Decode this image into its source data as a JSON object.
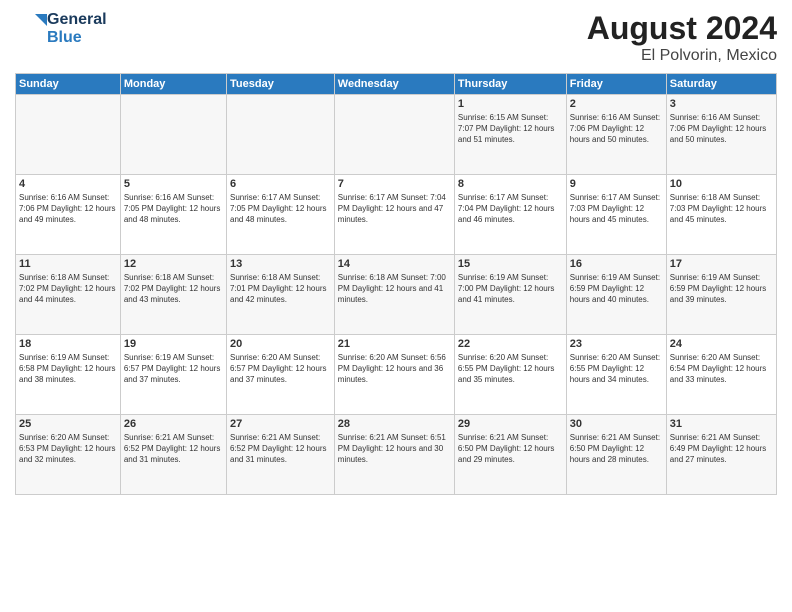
{
  "logo": {
    "line1": "General",
    "line2": "Blue"
  },
  "title": "August 2024",
  "subtitle": "El Polvorin, Mexico",
  "headers": [
    "Sunday",
    "Monday",
    "Tuesday",
    "Wednesday",
    "Thursday",
    "Friday",
    "Saturday"
  ],
  "weeks": [
    [
      {
        "day": "",
        "info": ""
      },
      {
        "day": "",
        "info": ""
      },
      {
        "day": "",
        "info": ""
      },
      {
        "day": "",
        "info": ""
      },
      {
        "day": "1",
        "info": "Sunrise: 6:15 AM\nSunset: 7:07 PM\nDaylight: 12 hours\nand 51 minutes."
      },
      {
        "day": "2",
        "info": "Sunrise: 6:16 AM\nSunset: 7:06 PM\nDaylight: 12 hours\nand 50 minutes."
      },
      {
        "day": "3",
        "info": "Sunrise: 6:16 AM\nSunset: 7:06 PM\nDaylight: 12 hours\nand 50 minutes."
      }
    ],
    [
      {
        "day": "4",
        "info": "Sunrise: 6:16 AM\nSunset: 7:06 PM\nDaylight: 12 hours\nand 49 minutes."
      },
      {
        "day": "5",
        "info": "Sunrise: 6:16 AM\nSunset: 7:05 PM\nDaylight: 12 hours\nand 48 minutes."
      },
      {
        "day": "6",
        "info": "Sunrise: 6:17 AM\nSunset: 7:05 PM\nDaylight: 12 hours\nand 48 minutes."
      },
      {
        "day": "7",
        "info": "Sunrise: 6:17 AM\nSunset: 7:04 PM\nDaylight: 12 hours\nand 47 minutes."
      },
      {
        "day": "8",
        "info": "Sunrise: 6:17 AM\nSunset: 7:04 PM\nDaylight: 12 hours\nand 46 minutes."
      },
      {
        "day": "9",
        "info": "Sunrise: 6:17 AM\nSunset: 7:03 PM\nDaylight: 12 hours\nand 45 minutes."
      },
      {
        "day": "10",
        "info": "Sunrise: 6:18 AM\nSunset: 7:03 PM\nDaylight: 12 hours\nand 45 minutes."
      }
    ],
    [
      {
        "day": "11",
        "info": "Sunrise: 6:18 AM\nSunset: 7:02 PM\nDaylight: 12 hours\nand 44 minutes."
      },
      {
        "day": "12",
        "info": "Sunrise: 6:18 AM\nSunset: 7:02 PM\nDaylight: 12 hours\nand 43 minutes."
      },
      {
        "day": "13",
        "info": "Sunrise: 6:18 AM\nSunset: 7:01 PM\nDaylight: 12 hours\nand 42 minutes."
      },
      {
        "day": "14",
        "info": "Sunrise: 6:18 AM\nSunset: 7:00 PM\nDaylight: 12 hours\nand 41 minutes."
      },
      {
        "day": "15",
        "info": "Sunrise: 6:19 AM\nSunset: 7:00 PM\nDaylight: 12 hours\nand 41 minutes."
      },
      {
        "day": "16",
        "info": "Sunrise: 6:19 AM\nSunset: 6:59 PM\nDaylight: 12 hours\nand 40 minutes."
      },
      {
        "day": "17",
        "info": "Sunrise: 6:19 AM\nSunset: 6:59 PM\nDaylight: 12 hours\nand 39 minutes."
      }
    ],
    [
      {
        "day": "18",
        "info": "Sunrise: 6:19 AM\nSunset: 6:58 PM\nDaylight: 12 hours\nand 38 minutes."
      },
      {
        "day": "19",
        "info": "Sunrise: 6:19 AM\nSunset: 6:57 PM\nDaylight: 12 hours\nand 37 minutes."
      },
      {
        "day": "20",
        "info": "Sunrise: 6:20 AM\nSunset: 6:57 PM\nDaylight: 12 hours\nand 37 minutes."
      },
      {
        "day": "21",
        "info": "Sunrise: 6:20 AM\nSunset: 6:56 PM\nDaylight: 12 hours\nand 36 minutes."
      },
      {
        "day": "22",
        "info": "Sunrise: 6:20 AM\nSunset: 6:55 PM\nDaylight: 12 hours\nand 35 minutes."
      },
      {
        "day": "23",
        "info": "Sunrise: 6:20 AM\nSunset: 6:55 PM\nDaylight: 12 hours\nand 34 minutes."
      },
      {
        "day": "24",
        "info": "Sunrise: 6:20 AM\nSunset: 6:54 PM\nDaylight: 12 hours\nand 33 minutes."
      }
    ],
    [
      {
        "day": "25",
        "info": "Sunrise: 6:20 AM\nSunset: 6:53 PM\nDaylight: 12 hours\nand 32 minutes."
      },
      {
        "day": "26",
        "info": "Sunrise: 6:21 AM\nSunset: 6:52 PM\nDaylight: 12 hours\nand 31 minutes."
      },
      {
        "day": "27",
        "info": "Sunrise: 6:21 AM\nSunset: 6:52 PM\nDaylight: 12 hours\nand 31 minutes."
      },
      {
        "day": "28",
        "info": "Sunrise: 6:21 AM\nSunset: 6:51 PM\nDaylight: 12 hours\nand 30 minutes."
      },
      {
        "day": "29",
        "info": "Sunrise: 6:21 AM\nSunset: 6:50 PM\nDaylight: 12 hours\nand 29 minutes."
      },
      {
        "day": "30",
        "info": "Sunrise: 6:21 AM\nSunset: 6:50 PM\nDaylight: 12 hours\nand 28 minutes."
      },
      {
        "day": "31",
        "info": "Sunrise: 6:21 AM\nSunset: 6:49 PM\nDaylight: 12 hours\nand 27 minutes."
      }
    ]
  ]
}
